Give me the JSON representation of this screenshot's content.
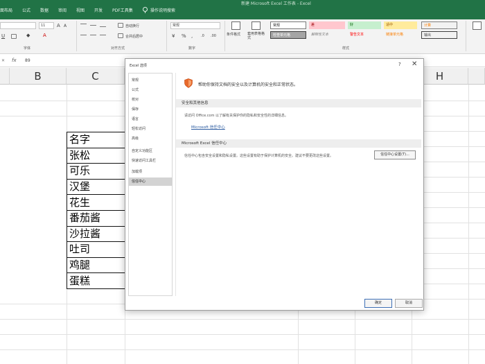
{
  "ribbon": {
    "tabs": [
      "面布局",
      "公式",
      "数据",
      "审阅",
      "视图",
      "开发",
      "PDF工具集"
    ],
    "tell_me": "操作说明搜索",
    "title": "新建 Microsoft Excel 工作表 - Excel",
    "font_size": "11",
    "wrap_text": "自动换行",
    "merge_center": "合并后居中",
    "number_format": "常规",
    "conditional_format": "条件格式",
    "format_as_table": "套用表格格式",
    "groups": {
      "font": "字体",
      "alignment": "对齐方式",
      "number": "数字",
      "styles": "样式"
    },
    "cell_styles": {
      "normal": "常规",
      "bad": "差",
      "good": "好",
      "neutral": "适中",
      "calculation": "计算",
      "check_cell": "检查单元格",
      "explanatory": "解释性文本",
      "warning": "警告文本",
      "linked_cell": "链接单元格",
      "output": "输出"
    }
  },
  "formula_bar": {
    "fx": "fx",
    "value": "89"
  },
  "grid": {
    "columns": [
      "B",
      "C",
      "H"
    ],
    "names": [
      "名字",
      "张松",
      "可乐",
      "汉堡",
      "花生",
      "番茄酱",
      "沙拉酱",
      "吐司",
      "鸡腿",
      "蛋糕"
    ]
  },
  "dialog": {
    "title": "Excel 选项",
    "help": "?",
    "close": "✕",
    "nav": [
      "常规",
      "公式",
      "校对",
      "保存",
      "语言",
      "轻松访问",
      "高级",
      "自定义功能区",
      "快速访问工具栏",
      "加载项",
      "信任中心"
    ],
    "selected_nav_index": 10,
    "intro": "帮助你保持文档的安全以及计算机的安全和正常状态。",
    "security_header": "安全和其他信息",
    "security_text": "请访问 Office.com 以了解有关保护你的隐私和安全性的详细信息。",
    "privacy_link": "Microsoft 信任中心",
    "trust_center_header": "Microsoft Excel 信任中心",
    "trust_center_text": "信任中心包含安全设置和隐私设置。这些设置有助于保护计算机的安全。建议不要更改这些设置。",
    "trust_center_button": "信任中心设置(T)...",
    "ok": "确定",
    "cancel": "取消"
  },
  "colors": {
    "ribbon_green": "#217346",
    "bad_fill": "#ffc7ce",
    "good_fill": "#c6efce",
    "neutral_fill": "#ffeb9c",
    "check_fill": "#a5a5a5",
    "calc_fill": "#f2f2f2",
    "link_color": "#2a5aa0",
    "selected_nav": "#d3d3d3"
  }
}
